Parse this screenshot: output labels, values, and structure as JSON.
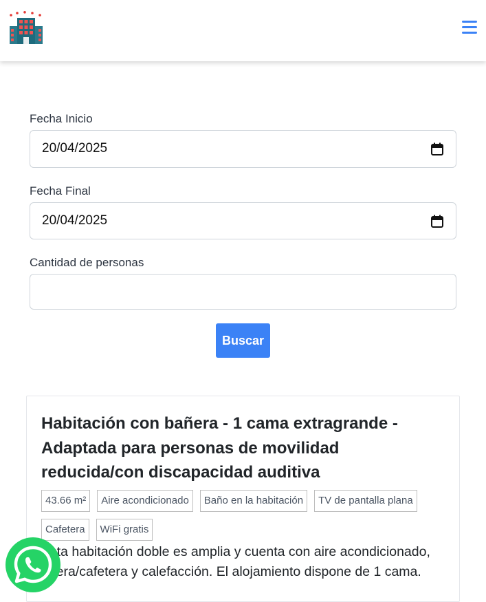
{
  "header": {
    "logo_icon": "hotel-building-icon",
    "menu_icon": "hamburger-menu-icon",
    "accent": "#3b82f6"
  },
  "form": {
    "start_label": "Fecha Inicio",
    "start_value": "20/04/2025",
    "end_label": "Fecha Final",
    "end_value": "20/04/2025",
    "people_label": "Cantidad de personas",
    "people_value": "",
    "search_button": "Buscar"
  },
  "room": {
    "title": "Habitación con bañera - 1 cama extragrande - Adaptada para personas de movilidad reducida/con discapacidad auditiva",
    "tags": [
      "43.66 m²",
      "Aire acondicionado",
      "Baño en la habitación",
      "TV de pantalla plana",
      "Cafetera",
      "WiFi gratis"
    ],
    "description": "Esta habitación doble es amplia y cuenta con aire acondicionado, tetera/cafetera y calefacción. El alojamiento dispone de 1 cama."
  },
  "whatsapp": {
    "icon": "whatsapp-icon",
    "color": "#25d366"
  }
}
